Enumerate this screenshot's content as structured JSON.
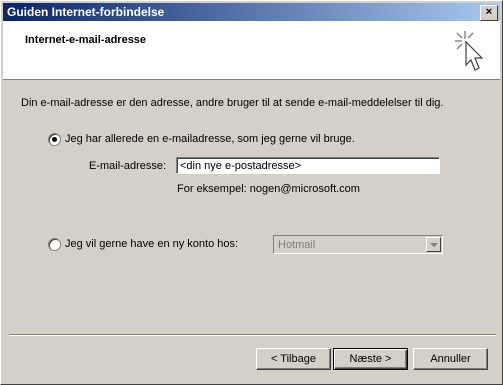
{
  "window": {
    "title": "Guiden Internet-forbindelse",
    "close_glyph": "×"
  },
  "header": {
    "page_title": "Internet-e-mail-adresse",
    "icon": "cursor-click-icon"
  },
  "intro_text": "Din e-mail-adresse er den adresse, andre bruger til at sende e-mail-meddelelser til dig.",
  "option_existing": {
    "label": "Jeg har allerede en e-mailadresse, som jeg gerne vil bruge.",
    "selected": true
  },
  "email": {
    "label": "E-mail-adresse:",
    "value": "<din nye e-postadresse>",
    "example": "For eksempel: nogen@microsoft.com"
  },
  "option_new": {
    "label": "Jeg vil gerne have en ny konto hos:",
    "selected": false,
    "provider_selected": "Hotmail"
  },
  "buttons": {
    "back": "< Tilbage",
    "next": "Næste >",
    "cancel": "Annuller"
  }
}
